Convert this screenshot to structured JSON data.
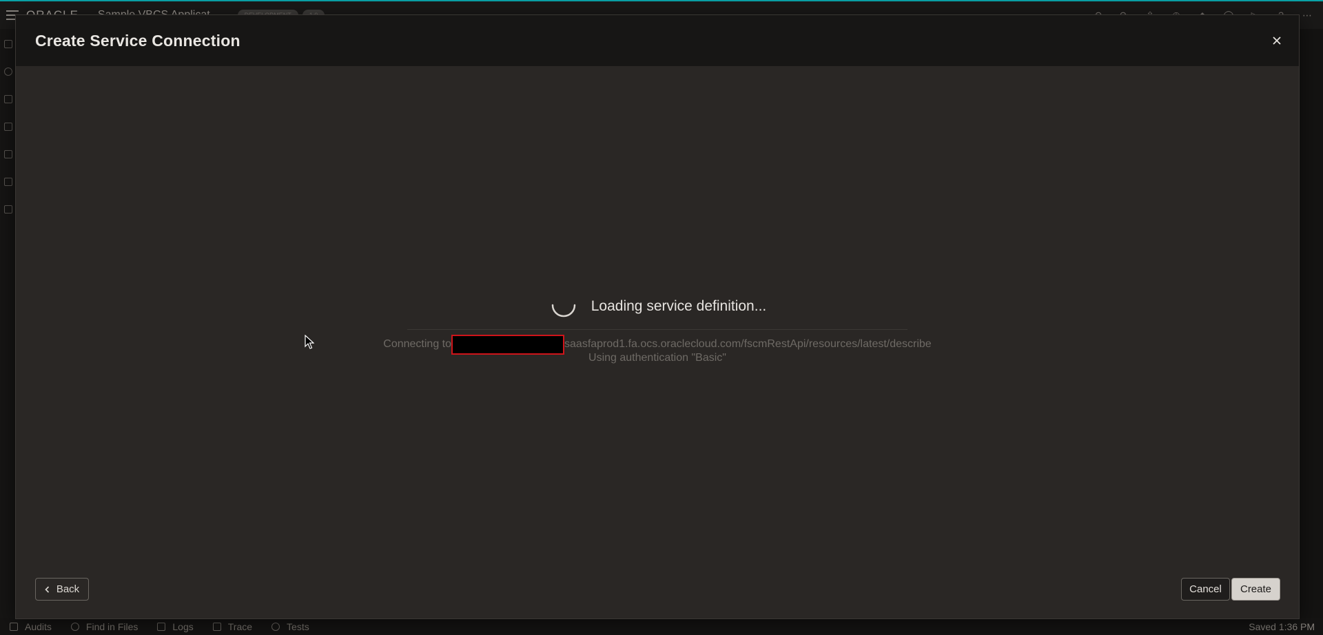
{
  "app": {
    "logo_text": "ORACLE",
    "title": "Sample VBCS Applicat",
    "badge_primary": "DEVELOPMENT",
    "badge_secondary": "1.0",
    "header_icons": [
      "undo-icon",
      "redo-icon",
      "share-icon",
      "clock-icon",
      "diamond-icon",
      "user-icon",
      "play-icon",
      "help-icon",
      "more-icon"
    ]
  },
  "dialog": {
    "title": "Create Service Connection",
    "close_label": "×",
    "loading_text": "Loading service definition...",
    "connecting_prefix": "Connecting to",
    "connecting_suffix": "saasfaprod1.fa.ocs.oraclecloud.com/fscmRestApi/resources/latest/describe",
    "auth_text": "Using authentication \"Basic\"",
    "back_label": "Back",
    "cancel_label": "Cancel",
    "create_label": "Create"
  },
  "statusbar": {
    "items": [
      {
        "label": "Audits",
        "icon": "audit-icon"
      },
      {
        "label": "Find in Files",
        "icon": "search-icon"
      },
      {
        "label": "Logs",
        "icon": "logs-icon"
      },
      {
        "label": "Trace",
        "icon": "trace-icon"
      },
      {
        "label": "Tests",
        "icon": "tests-icon"
      }
    ],
    "saved_text": "Saved 1:36 PM"
  },
  "colors": {
    "accent_strip": "#0aa3a8",
    "dialog_bg": "#2a2725",
    "header_bg": "#171615",
    "redaction_border": "#d0141a"
  }
}
